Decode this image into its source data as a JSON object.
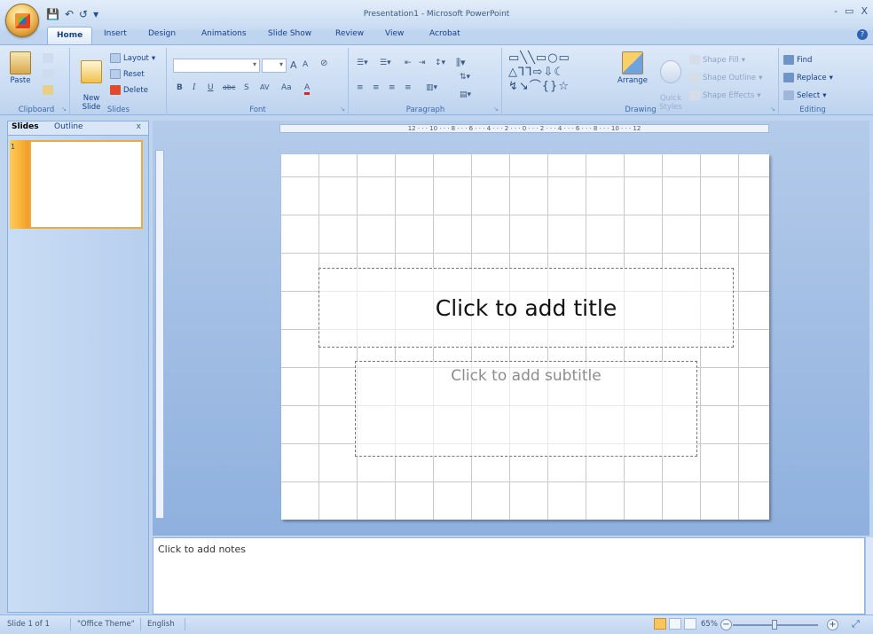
{
  "window": {
    "title": "Presentation1 - Microsoft PowerPoint",
    "minimize": "-",
    "restore": "▭",
    "close": "X"
  },
  "qat": {
    "save": "💾",
    "undo": "↶",
    "redo": "↺",
    "more": "▾"
  },
  "tabs": [
    "Home",
    "Insert",
    "Design",
    "Animations",
    "Slide Show",
    "Review",
    "View",
    "Acrobat"
  ],
  "ribbon": {
    "clipboard": {
      "label": "Clipboard",
      "paste": "Paste"
    },
    "slides": {
      "label": "Slides",
      "new_slide": "New\nSlide",
      "layout": "Layout",
      "reset": "Reset",
      "delete": "Delete"
    },
    "font": {
      "label": "Font",
      "bold": "B",
      "italic": "I",
      "underline": "U",
      "strike": "abc",
      "shadow": "S",
      "spacing": "AV",
      "case": "Aa",
      "color": "A",
      "grow": "A",
      "shrink": "A"
    },
    "paragraph": {
      "label": "Paragraph"
    },
    "drawing": {
      "label": "Drawing",
      "arrange": "Arrange",
      "quick_styles": "Quick\nStyles",
      "shape_fill": "Shape Fill",
      "shape_outline": "Shape Outline",
      "shape_effects": "Shape Effects"
    },
    "editing": {
      "label": "Editing",
      "find": "Find",
      "replace": "Replace",
      "select": "Select"
    }
  },
  "left_pane": {
    "tab_slides": "Slides",
    "tab_outline": "Outline",
    "close": "x",
    "slide_number": "1"
  },
  "ruler": {
    "horizontal": "12 · · · 10 · · · 8 · · · 6 · · · 4 · · · 2 · · · 0 · · · 2 · · · 4 · · · 6 · · · 8 · · · 10 · · · 12"
  },
  "slide": {
    "title_placeholder": "Click to add title",
    "subtitle_placeholder": "Click to add subtitle"
  },
  "notes": {
    "placeholder": "Click to add notes"
  },
  "status": {
    "slide": "Slide 1 of 1",
    "theme": "\"Office Theme\"",
    "language": "English",
    "zoom": "65%"
  }
}
